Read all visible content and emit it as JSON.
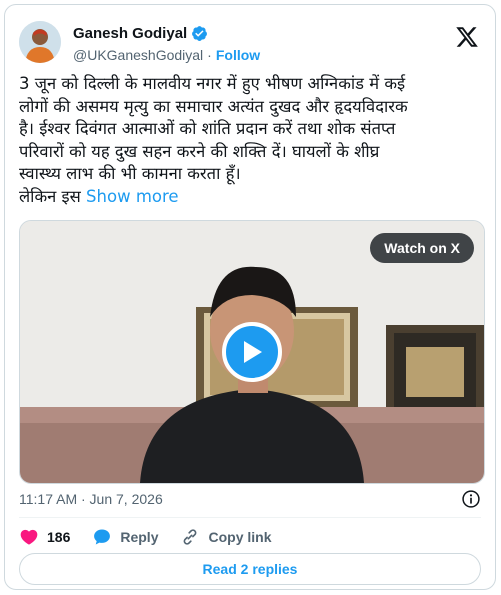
{
  "author": {
    "name": "Ganesh Godiyal",
    "handle": "@UKGaneshGodiyal",
    "separator": "·",
    "follow_label": "Follow",
    "verified_color": "#1d9bf0"
  },
  "tweet": {
    "text_lines": [
      "3 जून को दिल्ली के मालवीय नगर में हुए भीषण अग्निकांड में कई",
      "लोगों की असमय मृत्यु का समाचार अत्यंत दुखद और हृदयविदारक",
      "है। ईश्वर दिवंगत आत्माओं को शांति प्रदान करें तथा शोक संतप्त",
      "परिवारों को यह दुख सहन करने की शक्ति दें। घायलों के शीघ्र",
      "स्वास्थ्य लाभ की भी कामना करता हूँ।"
    ],
    "truncated_line": "लेकिन इस",
    "show_more_label": "Show more"
  },
  "media": {
    "watch_label": "Watch on X",
    "play_icon": "play-icon"
  },
  "meta": {
    "timestamp": "11:17 AM · Jun 7, 2026"
  },
  "actions": {
    "like_count": "186",
    "reply_label": "Reply",
    "copy_link_label": "Copy link"
  },
  "footer": {
    "read_replies_label": "Read 2 replies"
  },
  "colors": {
    "accent": "#1d9bf0",
    "like": "#f91880",
    "text": "#0f1419",
    "muted": "#536471"
  }
}
